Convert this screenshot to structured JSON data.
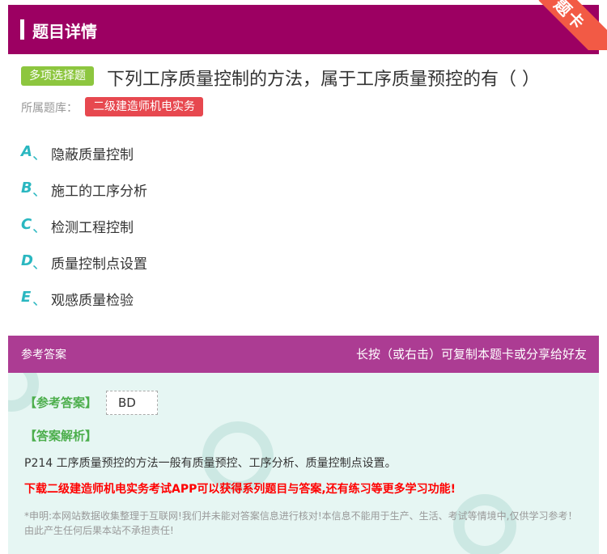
{
  "header": {
    "title": "题目详情",
    "ribbon": "题卡"
  },
  "question": {
    "type_tag": "多项选择题",
    "title": "下列工序质量控制的方法，属于工序质量预控的有（    ）",
    "bank_label": "所属题库：",
    "bank_name": "二级建造师机电实务",
    "options": [
      {
        "letter": "A",
        "sep": "、",
        "text": "隐蔽质量控制"
      },
      {
        "letter": "B",
        "sep": "、",
        "text": "施工的工序分析"
      },
      {
        "letter": "C",
        "sep": "、",
        "text": "检测工程控制"
      },
      {
        "letter": "D",
        "sep": "、",
        "text": "质量控制点设置"
      },
      {
        "letter": "E",
        "sep": "、",
        "text": "观感质量检验"
      }
    ]
  },
  "answer_bar": {
    "left": "参考答案",
    "right": "长按（或右击）可复制本题卡或分享给好友"
  },
  "answer": {
    "label": "【参考答案】",
    "value": "BD",
    "analysis_label": "【答案解析】",
    "analysis": "P214 工序质量预控的方法一般有质量预控、工序分析、质量控制点设置。",
    "download": "下载二级建造师机电实务考试APP可以获得系列题目与答案,还有练习等更多学习功能!",
    "disclaimer": "*申明:本网站数据收集整理于互联网!我们并未能对答案信息进行核对!本信息不能用于生产、生活、考试等情境中,仅供学习参考！由此产生任何后果本站不承担责任!"
  },
  "colors": {
    "header": "#9c0062",
    "ribbon": "#f25a45",
    "type_tag": "#8dc63f",
    "bank_tag": "#e7484f",
    "option_letter": "#2ab7c0",
    "answer_bar": "#ac3c93",
    "answer_panel": "#e6f6f3",
    "answer_label": "#4cae4c",
    "download": "#ff0000"
  }
}
